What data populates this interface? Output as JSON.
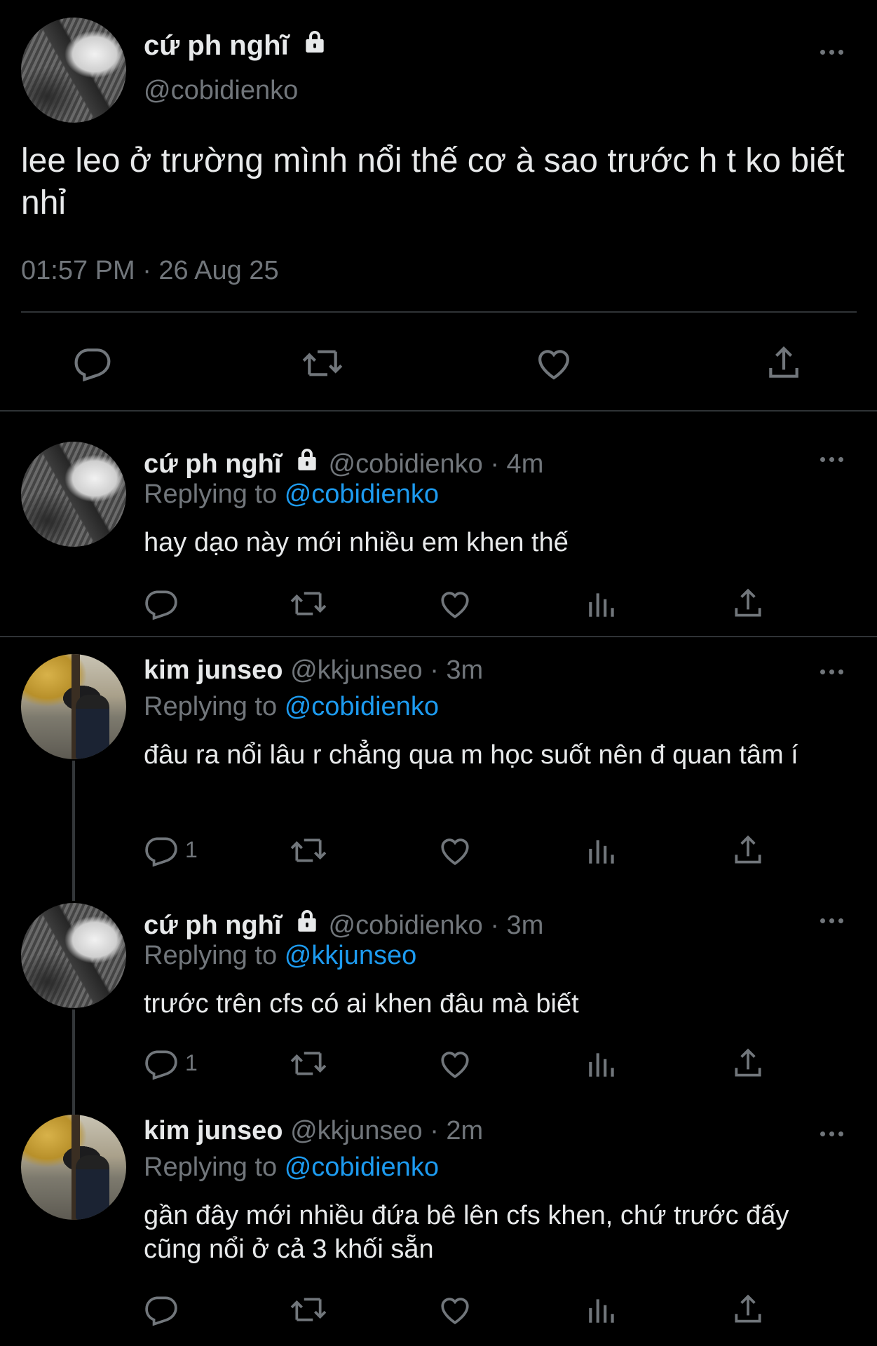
{
  "main_tweet": {
    "name": "cứ ph nghĩ",
    "handle": "@cobidienko",
    "text": "lee leo ở trường mình nổi thế cơ à sao trước h t ko biết nhỉ",
    "timestamp": "01:57 PM · 26 Aug 25"
  },
  "replies": [
    {
      "name": "cứ ph nghĩ",
      "handle": "@cobidienko",
      "time": "· 4m",
      "replying_label": "Replying to",
      "replying_to": "@cobidienko",
      "text": "hay dạo này mới nhiều em khen thế",
      "reply_count": ""
    },
    {
      "name": "kim junseo",
      "handle": "@kkjunseo",
      "time": "· 3m",
      "replying_label": "Replying to",
      "replying_to": "@cobidienko",
      "text": "đâu ra nổi lâu r chẳng qua m học suốt nên đ quan tâm í",
      "reply_count": "1"
    },
    {
      "name": "cứ ph nghĩ",
      "handle": "@cobidienko",
      "time": "· 3m",
      "replying_label": "Replying to",
      "replying_to": "@kkjunseo",
      "text": "trước trên cfs có ai khen đâu mà biết",
      "reply_count": "1"
    },
    {
      "name": "kim junseo",
      "handle": "@kkjunseo",
      "time": "· 2m",
      "replying_label": "Replying to",
      "replying_to": "@cobidienko",
      "text": "gần đây mới nhiều đứa bê lên cfs khen, chứ trước đấy cũng nổi ở cả 3 khối sẵn",
      "reply_count": ""
    }
  ],
  "icons": {
    "lock": "lock-icon",
    "reply": "reply-icon",
    "retweet": "retweet-icon",
    "like": "heart-icon",
    "views": "views-icon",
    "share": "share-icon",
    "more": "more-icon"
  },
  "colors": {
    "background": "#000000",
    "text": "#e7e9ea",
    "muted": "#71767b",
    "link": "#1d9bf0",
    "divider": "#2f3336"
  }
}
